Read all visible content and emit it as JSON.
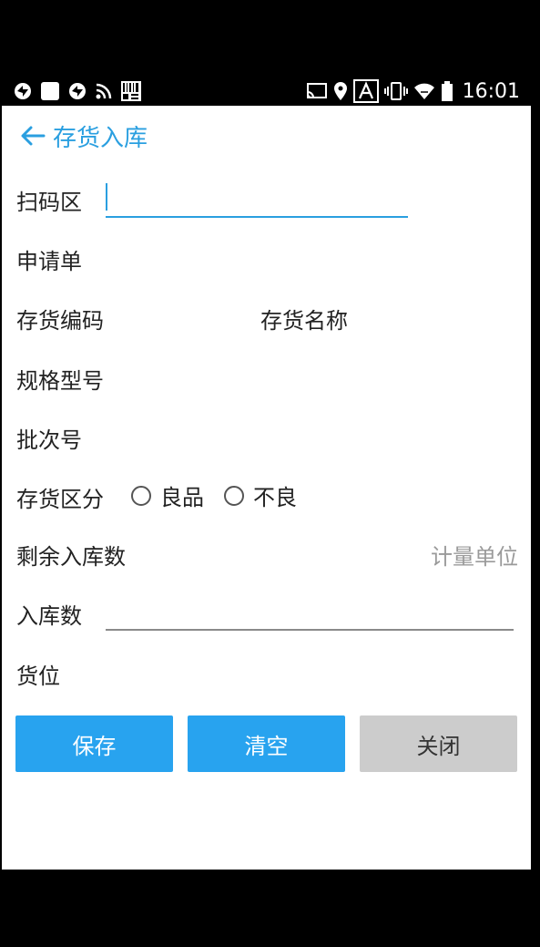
{
  "status_bar": {
    "time": "16:01",
    "left_icons": [
      "sync-icon",
      "square-icon",
      "sync-icon",
      "rss-icon",
      "barcode-icon"
    ],
    "right_icons": [
      "cast-icon",
      "location-icon",
      "a-icon",
      "vibrate-icon",
      "wifi-icon",
      "battery-icon"
    ]
  },
  "header": {
    "title": "存货入库"
  },
  "form": {
    "scan_label": "扫码区",
    "application_label": "申请单",
    "code_label": "存货编码",
    "name_label": "存货名称",
    "spec_label": "规格型号",
    "batch_label": "批次号",
    "category_label": "存货区分",
    "category_options": [
      "良品",
      "不良"
    ],
    "remaining_label": "剩余入库数",
    "unit_label": "计量单位",
    "qty_label": "入库数",
    "location_label": "货位"
  },
  "buttons": {
    "save": "保存",
    "clear": "清空",
    "close": "关闭"
  },
  "colors": {
    "accent": "#2a9fe0",
    "button_blue": "#28a3ef",
    "button_gray": "#cccccc"
  }
}
